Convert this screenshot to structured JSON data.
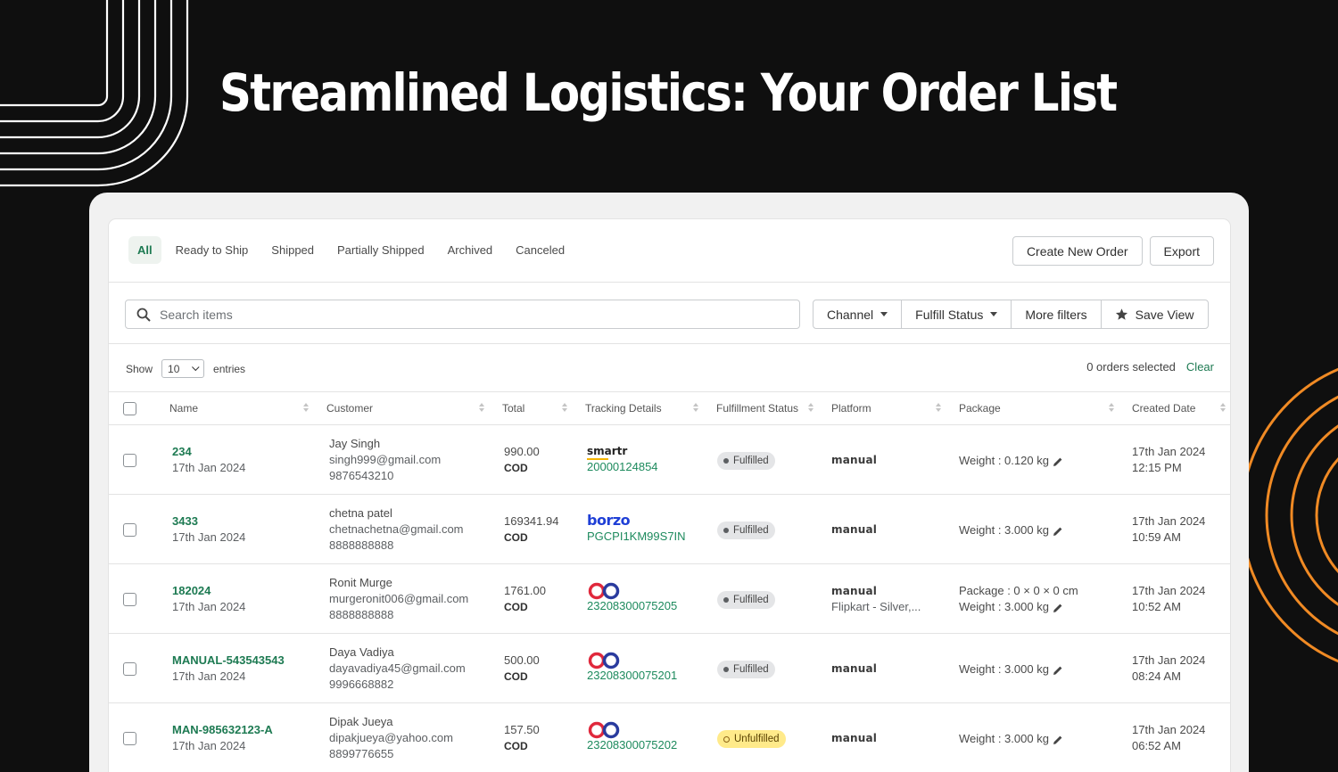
{
  "headline": "Streamlined Logistics: Your Order List",
  "colors": {
    "background": "#0f0f0f",
    "accent_green": "#1d7a52",
    "orange": "#f08a24"
  },
  "tabs": [
    {
      "label": "All",
      "active": true
    },
    {
      "label": "Ready to Ship"
    },
    {
      "label": "Shipped"
    },
    {
      "label": "Partially Shipped"
    },
    {
      "label": "Archived"
    },
    {
      "label": "Canceled"
    }
  ],
  "actions": {
    "create_label": "Create New Order",
    "export_label": "Export"
  },
  "filters": {
    "search_placeholder": "Search items",
    "channel_label": "Channel",
    "fulfill_status_label": "Fulfill Status",
    "more_filters_label": "More filters",
    "save_view_label": "Save View"
  },
  "entries": {
    "show_label": "Show",
    "value": "10",
    "entries_label": "entries"
  },
  "selection": {
    "text": "0 orders selected",
    "clear_label": "Clear"
  },
  "columns": [
    "Name",
    "Customer",
    "Total",
    "Tracking Details",
    "Fulfillment Status",
    "Platform",
    "Package",
    "Created Date"
  ],
  "orders": [
    {
      "name": "234",
      "date": "17th Jan 2024",
      "customer_name": "Jay Singh",
      "customer_email": "singh999@gmail.com",
      "customer_phone": "9876543210",
      "total": "990.00",
      "payment": "COD",
      "carrier": "smartr",
      "tracking": "20000124854",
      "status": "Fulfilled",
      "platform": "manual",
      "platform_sub": "",
      "package_line1": "Weight : 0.120 kg",
      "package_line2": "",
      "created_date": "17th Jan 2024",
      "created_time": "12:15 PM"
    },
    {
      "name": "3433",
      "date": "17th Jan 2024",
      "customer_name": "chetna patel",
      "customer_email": "chetnachetna@gmail.com",
      "customer_phone": "8888888888",
      "total": "169341.94",
      "payment": "COD",
      "carrier": "borzo",
      "tracking": "PGCPI1KM99S7IN",
      "status": "Fulfilled",
      "platform": "manual",
      "platform_sub": "",
      "package_line1": "Weight : 3.000 kg",
      "package_line2": "",
      "created_date": "17th Jan 2024",
      "created_time": "10:59 AM"
    },
    {
      "name": "182024",
      "date": "17th Jan 2024",
      "customer_name": "Ronit Murge",
      "customer_email": "murgeronit006@gmail.com",
      "customer_phone": "8888888888",
      "total": "1761.00",
      "payment": "COD",
      "carrier": "loop",
      "tracking": "23208300075205",
      "status": "Fulfilled",
      "platform": "manual",
      "platform_sub": "Flipkart - Silver,...",
      "package_line1": "Package : 0 × 0 × 0 cm",
      "package_line2": "Weight : 3.000 kg",
      "created_date": "17th Jan 2024",
      "created_time": "10:52 AM"
    },
    {
      "name": "MANUAL-543543543",
      "date": "17th Jan 2024",
      "customer_name": "Daya Vadiya",
      "customer_email": "dayavadiya45@gmail.com",
      "customer_phone": "9996668882",
      "total": "500.00",
      "payment": "COD",
      "carrier": "loop",
      "tracking": "23208300075201",
      "status": "Fulfilled",
      "platform": "manual",
      "platform_sub": "",
      "package_line1": "Weight : 3.000 kg",
      "package_line2": "",
      "created_date": "17th Jan 2024",
      "created_time": "08:24 AM"
    },
    {
      "name": "MAN-985632123-A",
      "date": "17th Jan 2024",
      "customer_name": "Dipak Jueya",
      "customer_email": "dipakjueya@yahoo.com",
      "customer_phone": "8899776655",
      "total": "157.50",
      "payment": "COD",
      "carrier": "loop",
      "tracking": "23208300075202",
      "status": "Unfulfilled",
      "platform": "manual",
      "platform_sub": "",
      "package_line1": "Weight : 3.000 kg",
      "package_line2": "",
      "created_date": "17th Jan 2024",
      "created_time": "06:52 AM"
    }
  ]
}
